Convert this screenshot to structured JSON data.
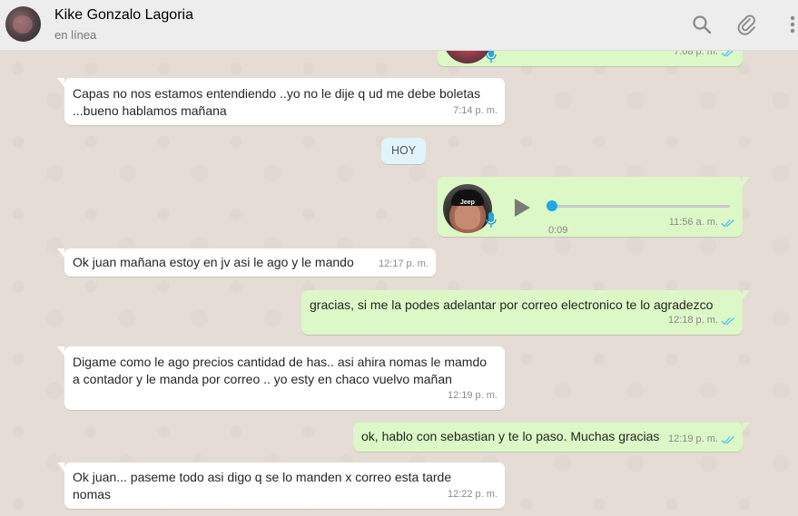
{
  "header": {
    "contact_name": "Kike Gonzalo Lagoria",
    "status": "en línea",
    "icons": [
      "search-icon",
      "attach-icon",
      "menu-icon"
    ]
  },
  "colors": {
    "incoming": "#ffffff",
    "outgoing": "#dcf8c6",
    "read_ticks": "#4fc3f7",
    "day_badge": "#e1f3fb",
    "voice_accent": "#21a6e6"
  },
  "day_separator": "HOY",
  "messages": [
    {
      "id": "m0",
      "type": "voice",
      "direction": "out",
      "time": "7:08 p. m."
    },
    {
      "id": "m1",
      "type": "text",
      "direction": "in",
      "text": "Capas no nos estamos entendiendo ..yo no le dije q ud me debe boletas\n...bueno hablamos mañana",
      "time": "7:14 p. m."
    },
    {
      "id": "m2",
      "type": "voice",
      "direction": "out",
      "duration": "0:09",
      "time": "11:56 a. m.",
      "progress": 0
    },
    {
      "id": "m3",
      "type": "text",
      "direction": "in",
      "text": "Ok juan mañana estoy en jv asi le ago y le mando",
      "time": "12:17 p. m."
    },
    {
      "id": "m4",
      "type": "text",
      "direction": "out",
      "text": "gracias, si me la podes adelantar por correo electronico te lo agradezco",
      "time": "12:18 p. m."
    },
    {
      "id": "m5",
      "type": "text",
      "direction": "in",
      "text": "Digame como le ago precios cantidad de has.. asi ahira nomas le mamdo\na contador y le manda por correo .. yo esty en chaco vuelvo mañan",
      "time": "12:19 p. m."
    },
    {
      "id": "m6",
      "type": "text",
      "direction": "out",
      "text": "ok, hablo con sebastian y te lo paso. Muchas gracias",
      "time": "12:19 p. m."
    },
    {
      "id": "m7",
      "type": "text",
      "direction": "in",
      "text": "Ok juan... paseme todo asi digo q se lo manden x correo esta tarde\nnomas",
      "time": "12:22 p. m."
    }
  ]
}
